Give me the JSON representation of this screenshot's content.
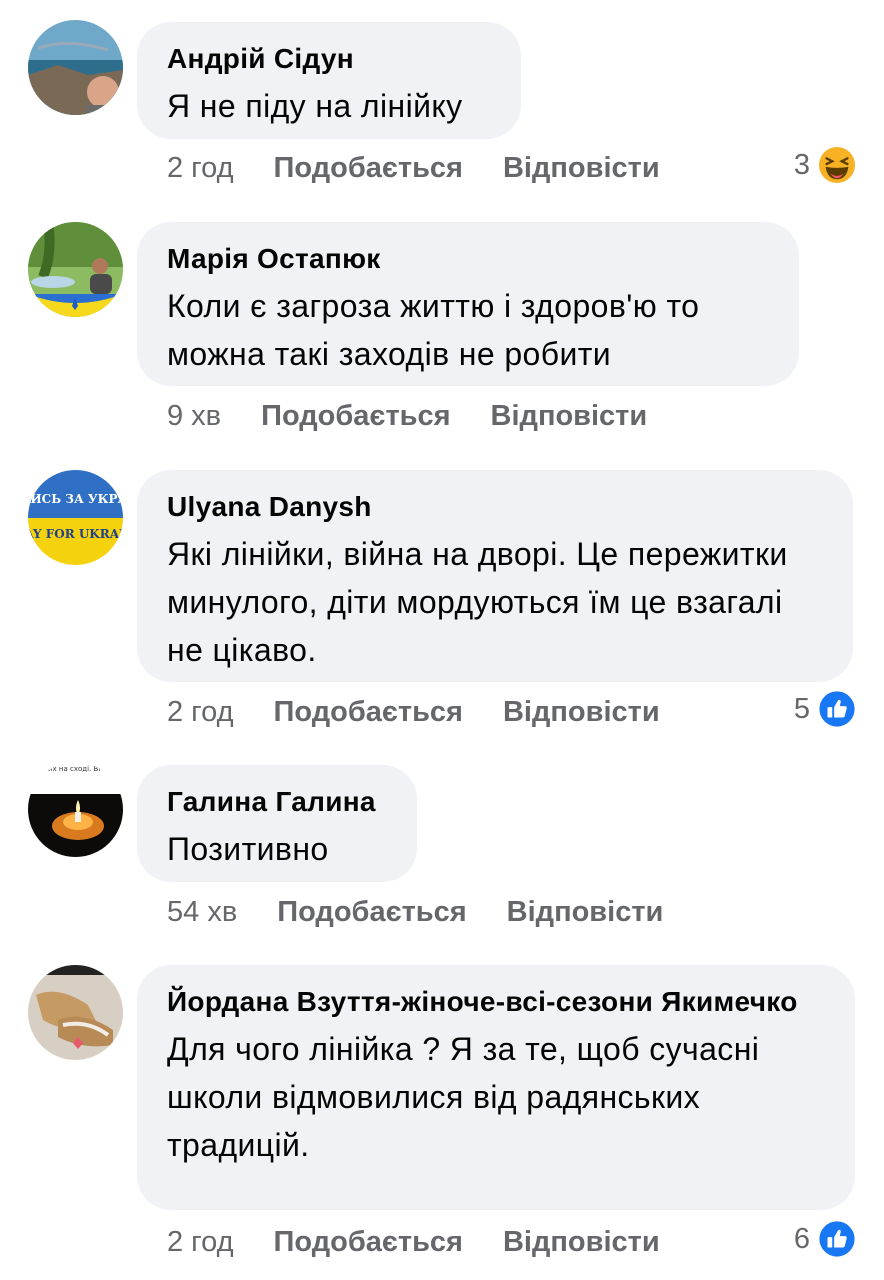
{
  "comments": [
    {
      "author": "Андрій Сідун",
      "text": "Я не піду на лінійку",
      "time": "2 год",
      "like_label": "Подобається",
      "reply_label": "Відповісти",
      "reaction_count": "3",
      "reaction_icon": "haha-emoji-icon"
    },
    {
      "author": "Марія Остапюк",
      "text": "Коли є загроза життю і здоров'ю то можна такі заходів не робити",
      "time": "9 хв",
      "like_label": "Подобається",
      "reply_label": "Відповісти"
    },
    {
      "author": "Ulyana Danysh",
      "text": "Які лінійки, війна на дворі. Це пережитки минулого, діти мордуються їм це взагалі не цікаво.",
      "time": "2 год",
      "like_label": "Подобається",
      "reply_label": "Відповісти",
      "reaction_count": "5",
      "reaction_icon": "like-thumb-icon",
      "avatar_text_top": "МОЛИСЬ ЗА УКРАЇНУ",
      "avatar_text_bottom": "PRAY FOR UKRAINE"
    },
    {
      "author": "Галина Галина",
      "text": "Позитивно",
      "time": "54 хв",
      "like_label": "Подобається",
      "reply_label": "Відповісти",
      "avatar_caption": "...и свічку пам... ...гтлих на сході. Вічн... м'ять вам хлопці."
    },
    {
      "author": "Йордана Взуття-жіноче-всі-сезони Якимечко",
      "text": "Для чого лінійка ?  Я за те, щоб сучасні школи відмовилися від радянських традицій.",
      "time": "2 год",
      "like_label": "Подобається",
      "reply_label": "Відповісти",
      "reaction_count": "6",
      "reaction_icon": "like-thumb-icon"
    }
  ],
  "colors": {
    "bubble": "#f0f2f5",
    "meta_text": "#65676b",
    "like_blue": "#1877f2",
    "haha_yellow": "#f7b125"
  }
}
